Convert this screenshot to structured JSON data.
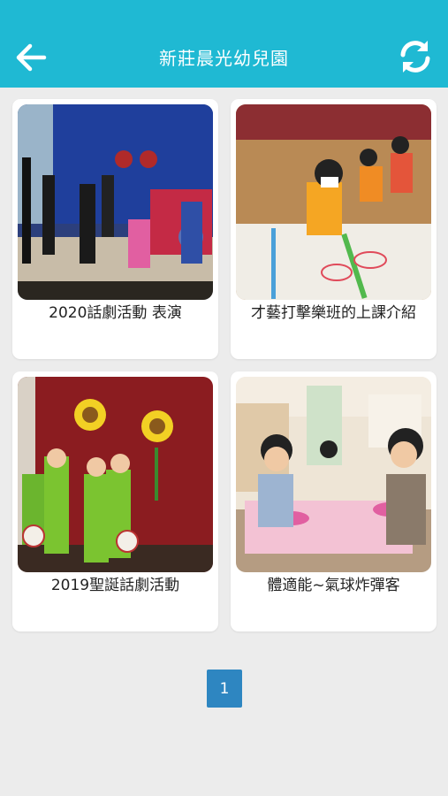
{
  "header": {
    "title": "新莊晨光幼兒園",
    "back_icon": "arrow-left-icon",
    "refresh_icon": "refresh-icon",
    "background_color": "#1fb9d3"
  },
  "albums": [
    {
      "caption": "2020話劇活動 表演"
    },
    {
      "caption": "才藝打擊樂班的上課介紹"
    },
    {
      "caption": "2019聖誕話劇活動"
    },
    {
      "caption": "體適能~氣球炸彈客"
    }
  ],
  "pagination": {
    "current_page": "1",
    "active_color": "#2e86c1"
  }
}
